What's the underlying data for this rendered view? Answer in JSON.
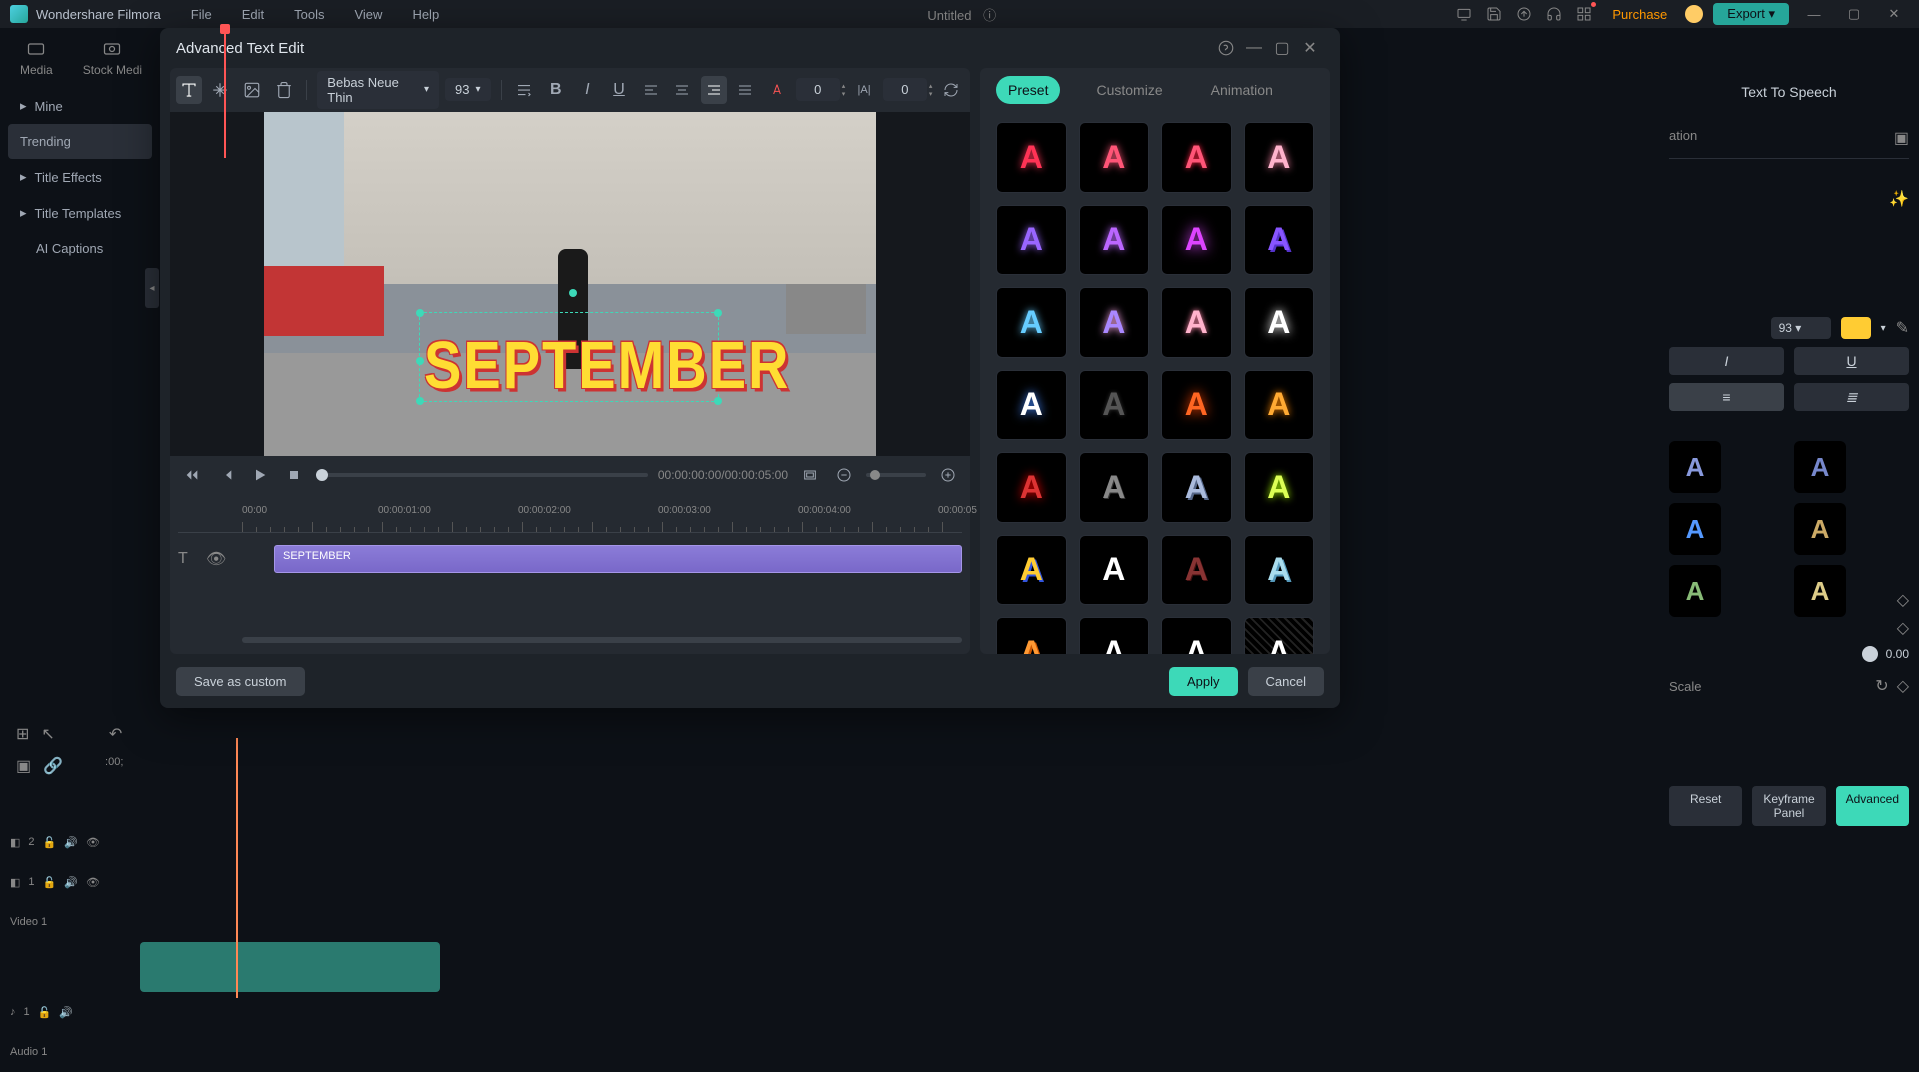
{
  "app": {
    "name": "Wondershare Filmora",
    "document_title": "Untitled"
  },
  "menubar": {
    "file": "File",
    "edit": "Edit",
    "tools": "Tools",
    "view": "View",
    "help": "Help"
  },
  "top_actions": {
    "purchase": "Purchase",
    "export": "Export"
  },
  "bg_media_tabs": {
    "media": "Media",
    "stock": "Stock Medi"
  },
  "bg_sidebar": {
    "mine": "Mine",
    "trending": "Trending",
    "title_effects": "Title Effects",
    "title_templates": "Title Templates",
    "ai_captions": "AI Captions"
  },
  "bg_right": {
    "title": "Text To Speech",
    "font_size": "93",
    "italic": "I",
    "underline": "U",
    "scale_label": "Scale",
    "scale_value": "0.00",
    "reset": "Reset",
    "keyframe": "Keyframe Panel",
    "advanced": "Advanced"
  },
  "bg_tracks": {
    "t2": "2",
    "t1": "1",
    "video1": "Video 1",
    "a1": "1",
    "audio1": "Audio 1"
  },
  "modal": {
    "title": "Advanced Text Edit",
    "font_name": "Bebas Neue Thin",
    "font_size": "93",
    "char_spacing": "0",
    "line_spacing": "0",
    "preview_text": "SEPTEMBER",
    "time_display": "00:00:00:00/00:00:05:00",
    "ruler": {
      "t0": "00:00",
      "t1": "00:00:01:00",
      "t2": "00:00:02:00",
      "t3": "00:00:03:00",
      "t4": "00:00:04:00",
      "t5": "00:00:05"
    },
    "clip_label": "SEPTEMBER",
    "tabs": {
      "preset": "Preset",
      "customize": "Customize",
      "animation": "Animation"
    },
    "footer": {
      "save": "Save as custom",
      "apply": "Apply",
      "cancel": "Cancel"
    }
  },
  "preset_styles": [
    {
      "color": "#ff3355",
      "shadow": "0 0 8px #ff3355"
    },
    {
      "color": "#ff5577",
      "shadow": "0 0 8px #ff5577"
    },
    {
      "color": "#ff5577",
      "shadow": "0 0 6px #ff2244"
    },
    {
      "color": "#ffb3cc",
      "shadow": "0 0 8px #ff88aa"
    },
    {
      "color": "#9966ff",
      "shadow": "0 0 8px #9966ff"
    },
    {
      "color": "#bb66ff",
      "shadow": "0 0 8px #bb66ff"
    },
    {
      "color": "#dd44ff",
      "shadow": "0 0 14px #dd44ff"
    },
    {
      "color": "#8855ff",
      "shadow": "2px 2px 0 #5533cc"
    },
    {
      "color": "#66ccff",
      "shadow": "0 0 8px #66ccff"
    },
    {
      "color": "#aa88ff",
      "shadow": "0 0 8px #ffaaee"
    },
    {
      "color": "#ffb3cc",
      "shadow": "0 0 6px #ff88aa"
    },
    {
      "color": "#ffffff",
      "shadow": "0 0 10px #fff"
    },
    {
      "color": "#ffffff",
      "shadow": "0 0 10px #4488ff"
    },
    {
      "color": "#555555",
      "shadow": "0 0 4px #333"
    },
    {
      "color": "#ff6622",
      "shadow": "0 0 12px #ff4400"
    },
    {
      "color": "#ffaa33",
      "shadow": "0 0 8px #ff8800"
    },
    {
      "color": "#dd3333",
      "shadow": "0 0 10px #ff0000"
    },
    {
      "color": "#888888",
      "shadow": "1px 1px 0 #333"
    },
    {
      "color": "#aabbdd",
      "shadow": "2px 2px 0 #556688"
    },
    {
      "color": "#ddff55",
      "shadow": "0 0 8px #aaff00"
    },
    {
      "color": "#ffcc33",
      "shadow": "2px 2px 0 #3355dd"
    },
    {
      "color": "#ffffff",
      "shadow": "2px 2px 0 #000,-2px -2px 0 #000"
    },
    {
      "color": "#883333",
      "shadow": "1px 1px 0 #441111"
    },
    {
      "color": "#aaddee",
      "shadow": "2px 2px 0 #5599bb"
    },
    {
      "color": "#ff9933",
      "shadow": "2px 2px 0 #cc5500"
    },
    {
      "color": "#ffffff",
      "shadow": "3px 3px 0 #000"
    },
    {
      "color": "#ffffff",
      "shadow": "1px 1px 0 #000"
    },
    {
      "color": "#ffffff",
      "shadow": "0 0 0 #000",
      "extra": "repeating"
    }
  ],
  "bg_style_colors": [
    "#8899dd",
    "#7788cc",
    "#5599ff",
    "#ccaa66",
    "#88bb77",
    "#ddcc88"
  ]
}
